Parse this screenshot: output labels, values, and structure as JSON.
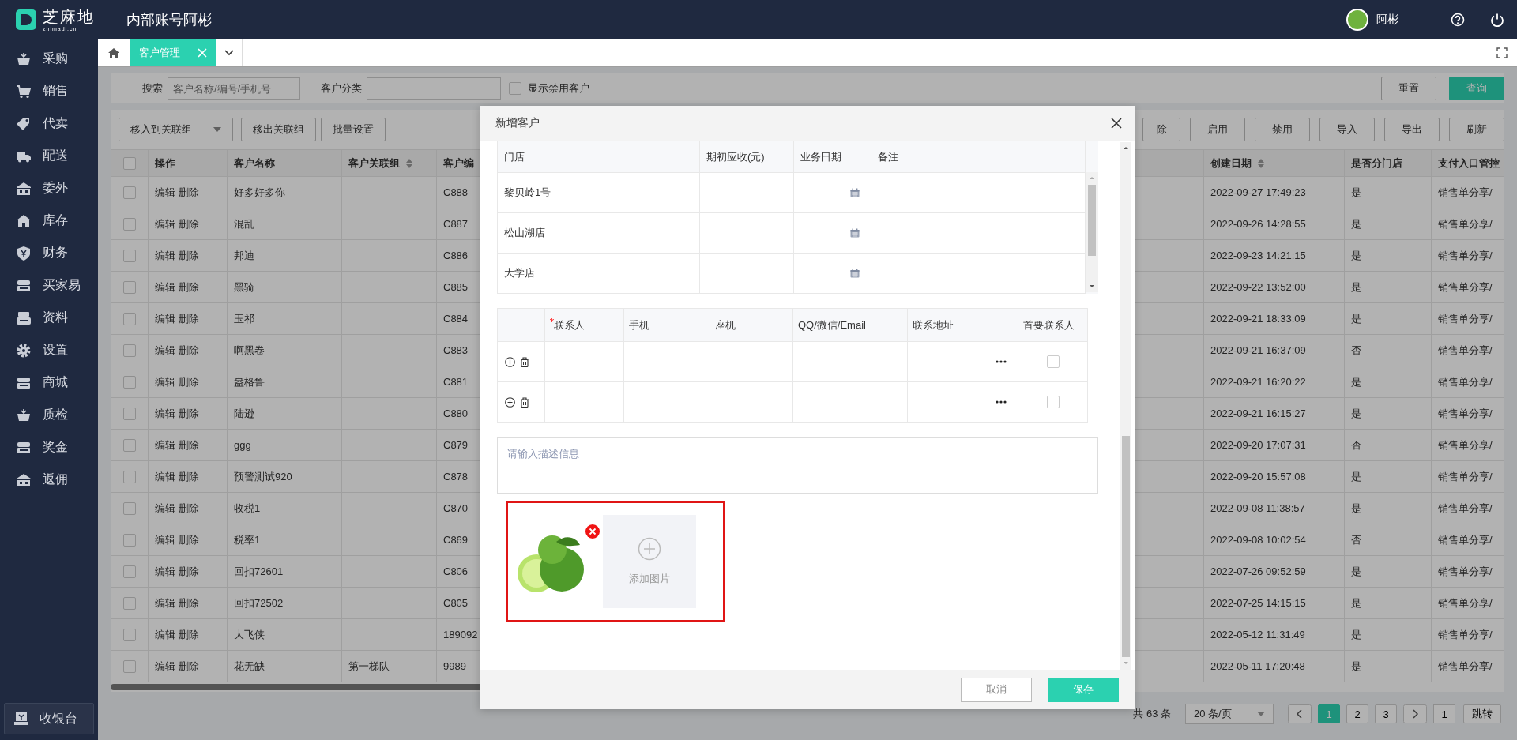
{
  "header": {
    "logo_text": "芝麻地",
    "logo_domain": "zhimadi.cn",
    "title": "内部账号阿彬",
    "user_name": "阿彬"
  },
  "sidebar": {
    "items": [
      {
        "label": "采购",
        "selected": false
      },
      {
        "label": "销售",
        "selected": false
      },
      {
        "label": "代卖",
        "selected": false
      },
      {
        "label": "配送",
        "selected": false
      },
      {
        "label": "委外",
        "selected": false
      },
      {
        "label": "库存",
        "selected": false
      },
      {
        "label": "财务",
        "selected": false
      },
      {
        "label": "买家易",
        "selected": false
      },
      {
        "label": "资料",
        "selected": false
      },
      {
        "label": "设置",
        "selected": false
      },
      {
        "label": "商城",
        "selected": false
      },
      {
        "label": "质检",
        "selected": false
      },
      {
        "label": "奖金",
        "selected": false
      },
      {
        "label": "返佣",
        "selected": false
      }
    ],
    "cashier_button": "收银台"
  },
  "tabs": [
    {
      "label": "客户管理",
      "selected": true
    }
  ],
  "search": {
    "label": "搜索",
    "placeholder": "客户名称/编号/手机号",
    "category_label": "客户分类",
    "show_disabled_label": "显示禁用客户",
    "show_disabled_checked": false,
    "buttons": [
      {
        "label": "重置",
        "kind": "default"
      },
      {
        "label": "查询",
        "kind": "primary"
      }
    ]
  },
  "toolbar": {
    "left": [
      {
        "label": "移入到关联组",
        "kind": "dropdown"
      },
      {
        "label": "移出关联组",
        "kind": "button"
      },
      {
        "label": "批量设置",
        "kind": "button"
      }
    ],
    "right": [
      "除",
      "启用",
      "禁用",
      "导入",
      "导出",
      "刷新"
    ]
  },
  "table": {
    "select_all_checked": false,
    "actions_header": "操作",
    "columns": [
      {
        "label": "客户名称",
        "sortable": false
      },
      {
        "label": "客户关联组",
        "sortable": true
      },
      {
        "label": "客户编",
        "sortable": false
      },
      {
        "label": "创建日期",
        "sortable": true
      },
      {
        "label": "是否分门店",
        "sortable": false
      },
      {
        "label": "支付入口管控",
        "sortable": false
      }
    ],
    "rows": [
      {
        "checked": false,
        "actions": [
          "编辑",
          "删除"
        ],
        "cells": [
          "好多好多你",
          "",
          "C888",
          "2022-09-27 17:49:23",
          "是",
          "销售单分享/"
        ]
      },
      {
        "checked": false,
        "actions": [
          "编辑",
          "删除"
        ],
        "cells": [
          "混乱",
          "",
          "C887",
          "2022-09-26 14:28:55",
          "是",
          "销售单分享/"
        ]
      },
      {
        "checked": false,
        "actions": [
          "编辑",
          "删除"
        ],
        "cells": [
          "邦迪",
          "",
          "C886",
          "2022-09-23 14:21:15",
          "是",
          "销售单分享/"
        ]
      },
      {
        "checked": false,
        "actions": [
          "编辑",
          "删除"
        ],
        "cells": [
          "黑骑",
          "",
          "C885",
          "2022-09-22 13:52:00",
          "是",
          "销售单分享/"
        ]
      },
      {
        "checked": false,
        "actions": [
          "编辑",
          "删除"
        ],
        "cells": [
          "玉祁",
          "",
          "C884",
          "2022-09-21 18:33:09",
          "是",
          "销售单分享/"
        ]
      },
      {
        "checked": false,
        "actions": [
          "编辑",
          "删除"
        ],
        "cells": [
          "啊黑卷",
          "",
          "C883",
          "2022-09-21 16:37:09",
          "否",
          "销售单分享/"
        ]
      },
      {
        "checked": false,
        "actions": [
          "编辑",
          "删除"
        ],
        "cells": [
          "盎格鲁",
          "",
          "C881",
          "2022-09-21 16:20:22",
          "是",
          "销售单分享/"
        ]
      },
      {
        "checked": false,
        "actions": [
          "编辑",
          "删除"
        ],
        "cells": [
          "陆逊",
          "",
          "C880",
          "2022-09-21 16:15:27",
          "是",
          "销售单分享/"
        ]
      },
      {
        "checked": false,
        "actions": [
          "编辑",
          "删除"
        ],
        "cells": [
          "ggg",
          "",
          "C879",
          "2022-09-20 17:07:31",
          "否",
          "销售单分享/"
        ]
      },
      {
        "checked": false,
        "actions": [
          "编辑",
          "删除"
        ],
        "cells": [
          "预警测试920",
          "",
          "C878",
          "2022-09-20 15:57:08",
          "是",
          "销售单分享/"
        ]
      },
      {
        "checked": false,
        "actions": [
          "编辑",
          "删除"
        ],
        "cells": [
          "收税1",
          "",
          "C870",
          "2022-09-08 11:38:57",
          "是",
          "销售单分享/"
        ]
      },
      {
        "checked": false,
        "actions": [
          "编辑",
          "删除"
        ],
        "cells": [
          "税率1",
          "",
          "C869",
          "2022-09-08 10:02:54",
          "否",
          "销售单分享/"
        ]
      },
      {
        "checked": false,
        "actions": [
          "编辑",
          "删除"
        ],
        "cells": [
          "回扣72601",
          "",
          "C806",
          "2022-07-26 09:52:59",
          "是",
          "销售单分享/"
        ]
      },
      {
        "checked": false,
        "actions": [
          "编辑",
          "删除"
        ],
        "cells": [
          "回扣72502",
          "",
          "C805",
          "2022-07-25 14:15:15",
          "是",
          "销售单分享/"
        ]
      },
      {
        "checked": false,
        "actions": [
          "编辑",
          "删除"
        ],
        "cells": [
          "大飞侠",
          "",
          "189092",
          "2022-05-12 11:31:49",
          "是",
          "销售单分享/"
        ]
      },
      {
        "checked": false,
        "actions": [
          "编辑",
          "删除"
        ],
        "cells": [
          "花无缺",
          "第一梯队",
          "9989",
          "2022-05-11 17:20:48",
          "是",
          "销售单分享/"
        ]
      }
    ]
  },
  "pagination": {
    "total": "共 63 条",
    "page_size": "20 条/页",
    "pages": [
      {
        "label": "1",
        "selected": true
      },
      {
        "label": "2",
        "selected": false
      },
      {
        "label": "3",
        "selected": false
      }
    ],
    "jump_value": "1",
    "jump_button": "跳转"
  },
  "modal": {
    "title": "新增客户",
    "stores": {
      "columns": [
        "门店",
        "期初应收(元)",
        "业务日期",
        "备注"
      ],
      "rows": [
        {
          "store": "黎贝岭1号"
        },
        {
          "store": "松山湖店"
        },
        {
          "store": "大学店"
        }
      ]
    },
    "contacts": {
      "columns": [
        {
          "label": "联系人",
          "required": true
        },
        {
          "label": "手机",
          "required": false
        },
        {
          "label": "座机",
          "required": false
        },
        {
          "label": "QQ/微信/Email",
          "required": false
        },
        {
          "label": "联系地址",
          "required": false
        },
        {
          "label": "首要联系人",
          "required": false
        }
      ],
      "rows": [
        {
          "primary": false
        },
        {
          "primary": false
        }
      ]
    },
    "description": {
      "placeholder": "请输入描述信息"
    },
    "upload": {
      "images": [
        {
          "removable": true
        }
      ],
      "add_label": "添加图片"
    },
    "buttons": [
      {
        "label": "取消",
        "kind": "default"
      },
      {
        "label": "保存",
        "kind": "primary"
      }
    ]
  }
}
